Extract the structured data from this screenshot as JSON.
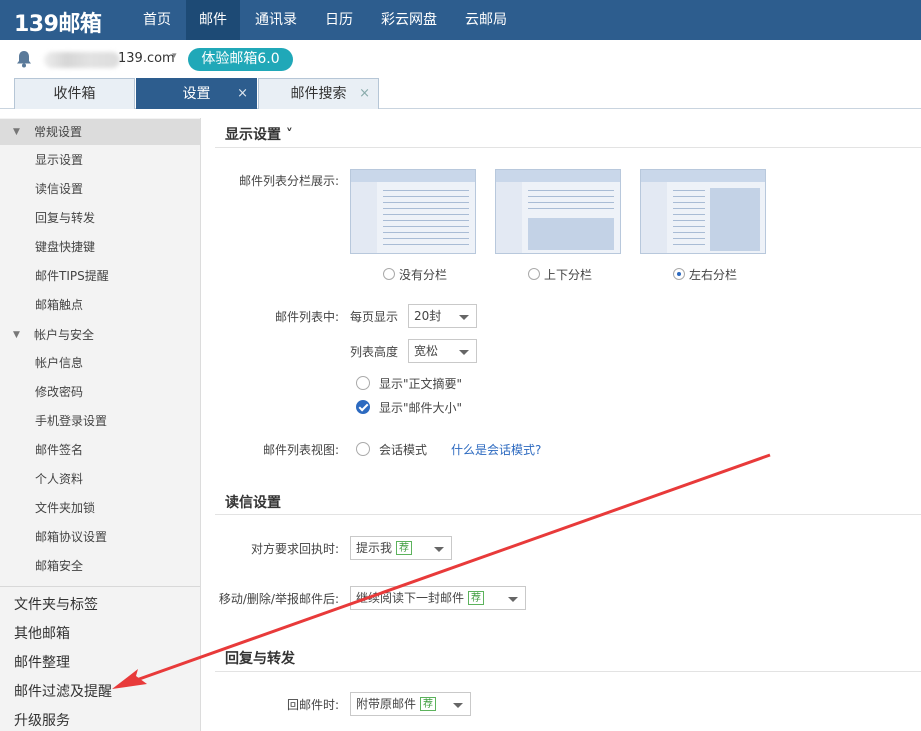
{
  "topbar": {
    "logo": "139邮箱",
    "nav": [
      "首页",
      "邮件",
      "通讯录",
      "日历",
      "彩云网盘",
      "云邮局"
    ],
    "active_nav": "邮件"
  },
  "account": {
    "email_domain": "139.com",
    "caret": "▾",
    "version_button": "体验邮箱6.0"
  },
  "tabs": [
    {
      "label": "收件箱",
      "closable": false
    },
    {
      "label": "设置",
      "closable": true
    },
    {
      "label": "邮件搜索",
      "closable": true
    }
  ],
  "tab_close_glyph": "×",
  "sidebar": {
    "groups": [
      {
        "label": "常规设置",
        "items": [
          "显示设置",
          "读信设置",
          "回复与转发",
          "键盘快捷键",
          "邮件TIPS提醒",
          "邮箱触点"
        ]
      },
      {
        "label": "帐户与安全",
        "items": [
          "帐户信息",
          "修改密码",
          "手机登录设置",
          "邮件签名",
          "个人资料",
          "文件夹加锁",
          "邮箱协议设置",
          "邮箱安全"
        ]
      }
    ],
    "top_items": [
      "文件夹与标签",
      "其他邮箱",
      "邮件整理",
      "邮件过滤及提醒",
      "升级服务"
    ]
  },
  "display_settings": {
    "title": "显示设置 ˅",
    "split_label": "邮件列表分栏展示:",
    "split_options": [
      {
        "label": "没有分栏",
        "selected": false
      },
      {
        "label": "上下分栏",
        "selected": false
      },
      {
        "label": "左右分栏",
        "selected": true
      }
    ],
    "list_label": "邮件列表中:",
    "per_page_label": "每页显示",
    "per_page_value": "20封",
    "height_label": "列表高度",
    "height_value": "宽松",
    "show_summary": {
      "label": "显示\"正文摘要\"",
      "checked": false
    },
    "show_size": {
      "label": "显示\"邮件大小\"",
      "checked": true
    },
    "view_label": "邮件列表视图:",
    "conversation_label": "会话模式",
    "conversation_link": "什么是会话模式?"
  },
  "read_settings": {
    "title": "读信设置",
    "receipt_label": "对方要求回执时:",
    "receipt_value": "提示我",
    "after_label": "移动/删除/举报邮件后:",
    "after_value": "继续阅读下一封邮件",
    "recommend_tag": "荐"
  },
  "reply_settings": {
    "title": "回复与转发",
    "reply_label": "回邮件时:",
    "reply_value": "附带原邮件"
  },
  "colors": {
    "topbar": "#2d5d8e",
    "version_button": "#20a8b8",
    "annotation_arrow": "#e83a3a",
    "link": "#2d6ac0"
  }
}
